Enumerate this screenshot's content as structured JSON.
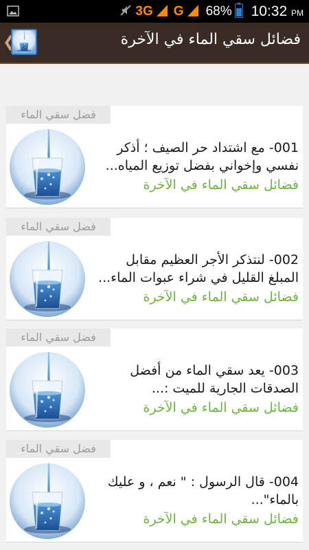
{
  "status_bar": {
    "network_3g": "3G",
    "network_g": "G",
    "battery_percent": "68%",
    "time": "10:32",
    "ampm": "PM",
    "icons": [
      "image-icon",
      "mute-icon",
      "signal-icon",
      "battery-icon"
    ]
  },
  "app_bar": {
    "title": "فضائل سقي الماء في الآخرة",
    "icon": "water-glass-app-icon"
  },
  "colors": {
    "app_bar": "#3a2b24",
    "link_green": "#6db33f",
    "network_orange": "#ff8c00"
  },
  "list": {
    "items": [
      {
        "tag": "فضل سقي الماء",
        "title": "001- مع اشتداد حر الصيف ؛ أذكر نفسي وإخواني بفضل توزيع المياه...",
        "meta": "فضائل سقي الماء في الآخرة",
        "thumbnail": "water-glass-image"
      },
      {
        "tag": "فضل سقي الماء",
        "title": "002- لنتذكر الأجر العظيم مقابل المبلغ القليل في شراء عبوات الماء...",
        "meta": "فضائل سقي الماء في الآخرة",
        "thumbnail": "water-glass-image"
      },
      {
        "tag": "فضل سقي الماء",
        "title": "003- يعد سقي الماء من أفضل الصدقات الجارية للميت :...",
        "meta": "فضائل سقي الماء في الآخرة",
        "thumbnail": "water-glass-image"
      },
      {
        "tag": "فضل سقي الماء",
        "title": "004- قال الرسول : \" نعم ، و عليك بالماء\"...",
        "meta": "فضائل سقي الماء في الآخرة",
        "thumbnail": "water-glass-image"
      }
    ]
  }
}
